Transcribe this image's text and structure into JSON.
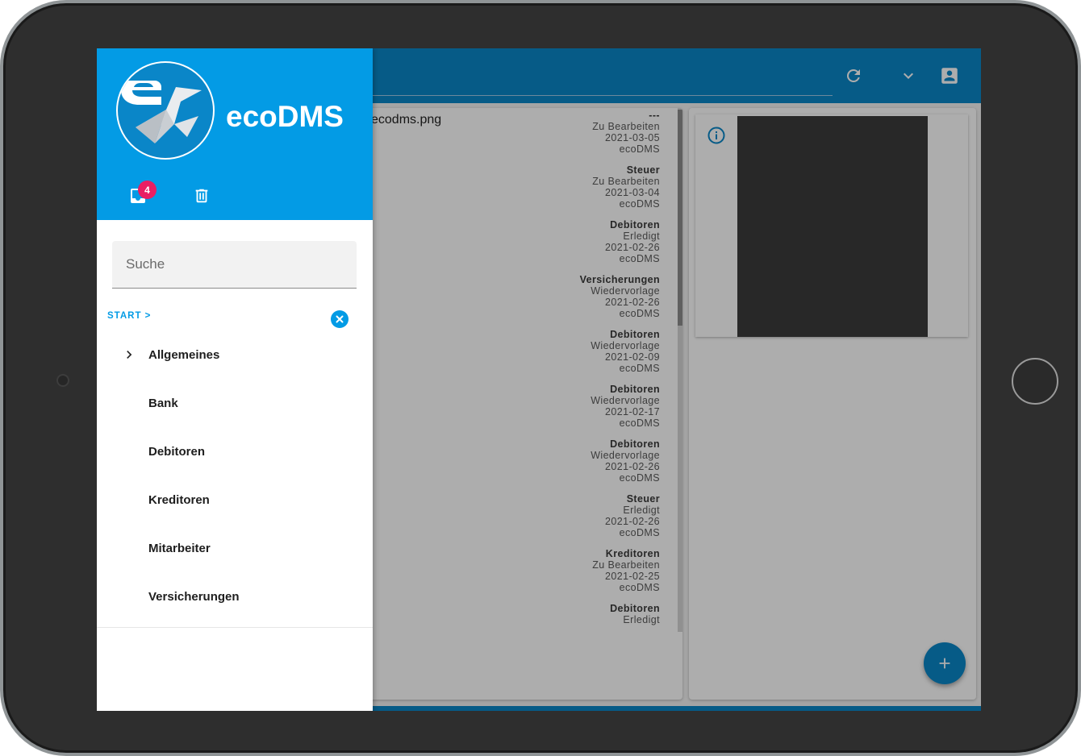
{
  "app": {
    "brand": "ecoDMS",
    "accent_color": "#039be5",
    "topbar_color": "#0a86c8",
    "inbox_badge": "4"
  },
  "toolbar": {
    "icons": [
      "refresh-icon",
      "chevron-down-icon",
      "account-box-icon"
    ]
  },
  "document": {
    "filename": "ecodms.png",
    "entries": [
      {
        "category": "---",
        "status": "Zu Bearbeiten",
        "date": "2021-03-05",
        "user": "ecoDMS"
      },
      {
        "category": "Steuer",
        "status": "Zu Bearbeiten",
        "date": "2021-03-04",
        "user": "ecoDMS"
      },
      {
        "category": "Debitoren",
        "status": "Erledigt",
        "date": "2021-02-26",
        "user": "ecoDMS"
      },
      {
        "category": "Versicherungen",
        "status": "Wiedervorlage",
        "date": "2021-02-26",
        "user": "ecoDMS"
      },
      {
        "category": "Debitoren",
        "status": "Wiedervorlage",
        "date": "2021-02-09",
        "user": "ecoDMS"
      },
      {
        "category": "Debitoren",
        "status": "Wiedervorlage",
        "date": "2021-02-17",
        "user": "ecoDMS"
      },
      {
        "category": "Debitoren",
        "status": "Wiedervorlage",
        "date": "2021-02-26",
        "user": "ecoDMS"
      },
      {
        "category": "Steuer",
        "status": "Erledigt",
        "date": "2021-02-26",
        "user": "ecoDMS"
      },
      {
        "category": "Kreditoren",
        "status": "Zu Bearbeiten",
        "date": "2021-02-25",
        "user": "ecoDMS"
      },
      {
        "category": "Debitoren",
        "status": "Erledigt"
      }
    ]
  },
  "drawer": {
    "search": {
      "placeholder": "Suche",
      "value": ""
    },
    "breadcrumb": "START >",
    "items": [
      {
        "label": "Allgemeines",
        "expandable": true
      },
      {
        "label": "Bank",
        "expandable": false
      },
      {
        "label": "Debitoren",
        "expandable": false
      },
      {
        "label": "Kreditoren",
        "expandable": false
      },
      {
        "label": "Mitarbeiter",
        "expandable": false
      },
      {
        "label": "Versicherungen",
        "expandable": false
      }
    ]
  }
}
